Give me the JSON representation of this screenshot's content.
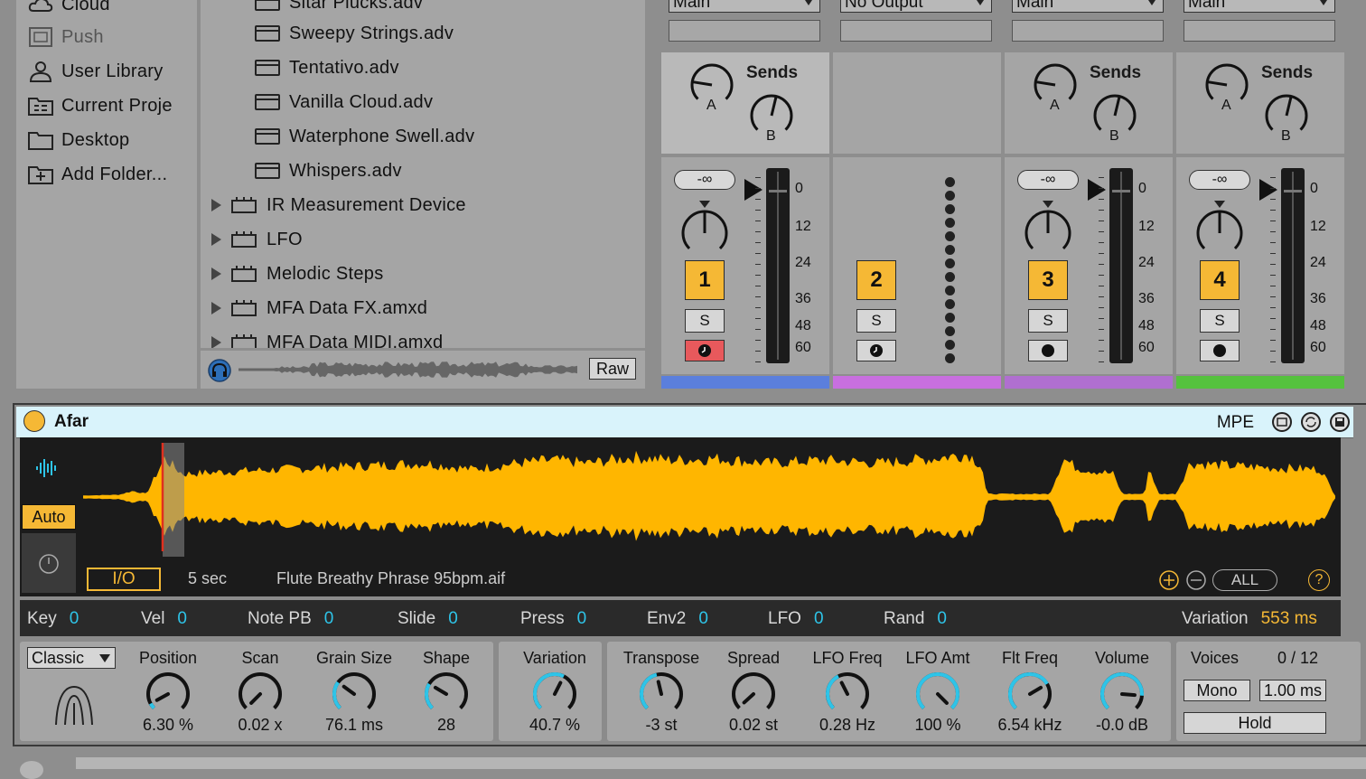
{
  "places": [
    {
      "label": "Cloud",
      "icon": "cloud-icon",
      "dim": false
    },
    {
      "label": "Push",
      "icon": "push-icon",
      "dim": true
    },
    {
      "label": "User Library",
      "icon": "user-icon",
      "dim": false
    },
    {
      "label": "Current Proje",
      "icon": "project-folder-icon",
      "dim": false
    },
    {
      "label": "Desktop",
      "icon": "folder-icon",
      "dim": false
    },
    {
      "label": "Add Folder...",
      "icon": "add-folder-icon",
      "dim": false
    }
  ],
  "browser": {
    "files": [
      "Sitar Plucks.adv",
      "Sweepy Strings.adv",
      "Tentativo.adv",
      "Vanilla Cloud.adv",
      "Waterphone Swell.adv",
      "Whispers.adv"
    ],
    "devices": [
      "IR Measurement Device",
      "LFO",
      "Melodic Steps",
      "MFA Data FX.amxd",
      "MFA Data MIDI.amxd"
    ],
    "raw_label": "Raw"
  },
  "mixer": {
    "sends_label": "Sends",
    "send_a": "A",
    "send_b": "B",
    "volume": "-∞",
    "solo_label": "S",
    "scale": [
      "0",
      "12",
      "24",
      "36",
      "48",
      "60"
    ],
    "tracks": [
      {
        "output": "Main",
        "number": "1",
        "color": "#5b7fdc",
        "arm": "on"
      },
      {
        "output": "No Output",
        "number": "2",
        "color": "#c86fdf",
        "arm": "clock"
      },
      {
        "output": "Main",
        "number": "3",
        "color": "#b06fd0",
        "arm": "off"
      },
      {
        "output": "Main",
        "number": "4",
        "color": "#55c23e",
        "arm": "off"
      }
    ]
  },
  "device": {
    "name": "Afar",
    "mpe_label": "MPE",
    "auto_label": "Auto",
    "io_label": "I/O",
    "duration": "5 sec",
    "sample_name": "Flute Breathy Phrase 95bpm.aif",
    "all_label": "ALL",
    "help_label": "?",
    "mods": [
      {
        "label": "Key",
        "value": "0"
      },
      {
        "label": "Vel",
        "value": "0"
      },
      {
        "label": "Note PB",
        "value": "0"
      },
      {
        "label": "Slide",
        "value": "0"
      },
      {
        "label": "Press",
        "value": "0"
      },
      {
        "label": "Env2",
        "value": "0"
      },
      {
        "label": "LFO",
        "value": "0"
      },
      {
        "label": "Rand",
        "value": "0"
      }
    ],
    "variation_label": "Variation",
    "variation_value": "553 ms",
    "mode": "Classic",
    "knobs": [
      {
        "label": "Position",
        "value": "6.30 %",
        "level": 0.06
      },
      {
        "label": "Scan",
        "value": "0.02 x",
        "level": 0.0
      },
      {
        "label": "Grain Size",
        "value": "76.1 ms",
        "level": 0.3
      },
      {
        "label": "Shape",
        "value": "28",
        "level": 0.28
      },
      {
        "label": "Variation",
        "value": "40.7 %",
        "level": 0.6
      },
      {
        "label": "Transpose",
        "value": "-3 st",
        "level": 0.45
      },
      {
        "label": "Spread",
        "value": "0.02 st",
        "level": 0.01
      },
      {
        "label": "LFO Freq",
        "value": "0.28 Hz",
        "level": 0.4
      },
      {
        "label": "LFO Amt",
        "value": "100 %",
        "level": 1.0
      },
      {
        "label": "Flt Freq",
        "value": "6.54 kHz",
        "level": 0.72
      },
      {
        "label": "Volume",
        "value": "-0.0 dB",
        "level": 0.85
      }
    ],
    "voices_label": "Voices",
    "voices_value": "0 / 12",
    "mono_label": "Mono",
    "glide_value": "1.00 ms",
    "hold_label": "Hold"
  },
  "colors": {
    "accent": "#f5b835",
    "wave": "#ffb600",
    "mod_value": "#2ec4e8"
  }
}
